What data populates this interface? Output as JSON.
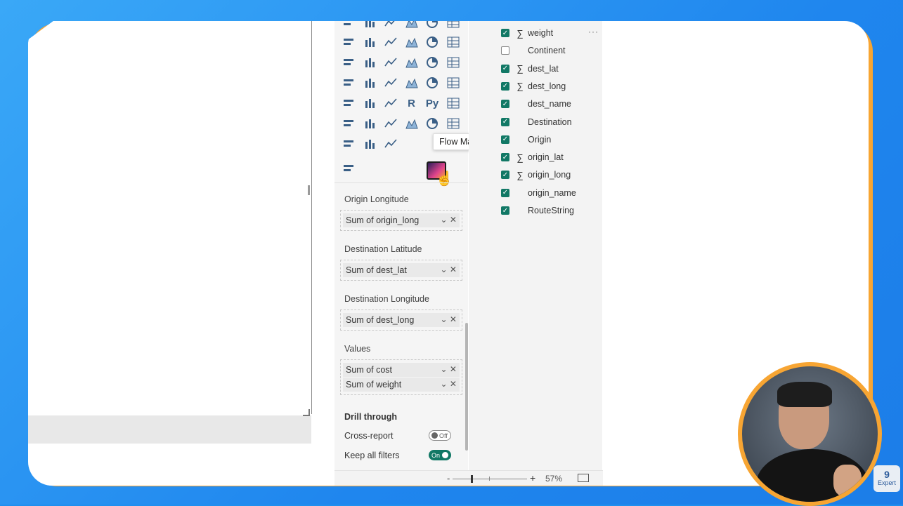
{
  "tooltip": "Flow Map",
  "wells": [
    {
      "label": "Origin Longitude",
      "pills": [
        "Sum of origin_long"
      ]
    },
    {
      "label": "Destination Latitude",
      "pills": [
        "Sum of dest_lat"
      ]
    },
    {
      "label": "Destination Longitude",
      "pills": [
        "Sum of dest_long"
      ]
    },
    {
      "label": "Values",
      "pills": [
        "Sum of cost",
        "Sum of weight"
      ]
    }
  ],
  "drill": {
    "title": "Drill through",
    "cross_report_label": "Cross-report",
    "cross_report_state": "Off",
    "keep_filters_label": "Keep all filters",
    "keep_filters_state": "On"
  },
  "fields": [
    {
      "name": "weight",
      "checked": true,
      "sigma": true
    },
    {
      "name": "Continent",
      "checked": false,
      "sigma": false
    },
    {
      "name": "dest_lat",
      "checked": true,
      "sigma": true
    },
    {
      "name": "dest_long",
      "checked": true,
      "sigma": true
    },
    {
      "name": "dest_name",
      "checked": true,
      "sigma": false
    },
    {
      "name": "Destination",
      "checked": true,
      "sigma": false
    },
    {
      "name": "Origin",
      "checked": true,
      "sigma": false
    },
    {
      "name": "origin_lat",
      "checked": true,
      "sigma": true
    },
    {
      "name": "origin_long",
      "checked": true,
      "sigma": true
    },
    {
      "name": "origin_name",
      "checked": true,
      "sigma": false
    },
    {
      "name": "RouteString",
      "checked": true,
      "sigma": false
    }
  ],
  "more_options": "···",
  "zoom": {
    "minus": "-",
    "plus": "+",
    "percent": "57%",
    "level": 57
  },
  "visual_icons": [
    "stacked-bar-icon",
    "clustered-column-icon",
    "stacked-bar-100-icon",
    "clustered-column-2-icon",
    "bar-chart-icon",
    "column-chart-icon",
    "line-chart-icon",
    "area-chart-icon",
    "stacked-area-icon",
    "line-area-icon",
    "line-column-icon",
    "ribbon-chart-icon",
    "waterfall-icon",
    "funnel-icon",
    "scatter-icon",
    "pie-icon",
    "donut-icon",
    "treemap-icon",
    "map-icon",
    "filled-map-icon",
    "azure-map-icon",
    "gauge-icon",
    "card-icon",
    "kpi-icon",
    "slicer-icon",
    "table-icon",
    "matrix-icon",
    "r-visual-icon",
    "python-visual-icon",
    "key-influencers-icon",
    "decomposition-tree-icon",
    "qa-icon",
    "paginated-report-icon",
    "smart-narrative-icon",
    "metrics-icon",
    "image-icon",
    "power-apps-icon",
    "power-automate-icon",
    "arcgis-icon",
    "globe-map-icon",
    "shape-map-icon",
    "trophy-icon",
    "custom-visual-icon"
  ],
  "presenter_logo": {
    "num": "9",
    "text": "Expert"
  },
  "colors": {
    "accent": "#117865",
    "frame": "#f7a533",
    "background": "#1f86ee"
  }
}
